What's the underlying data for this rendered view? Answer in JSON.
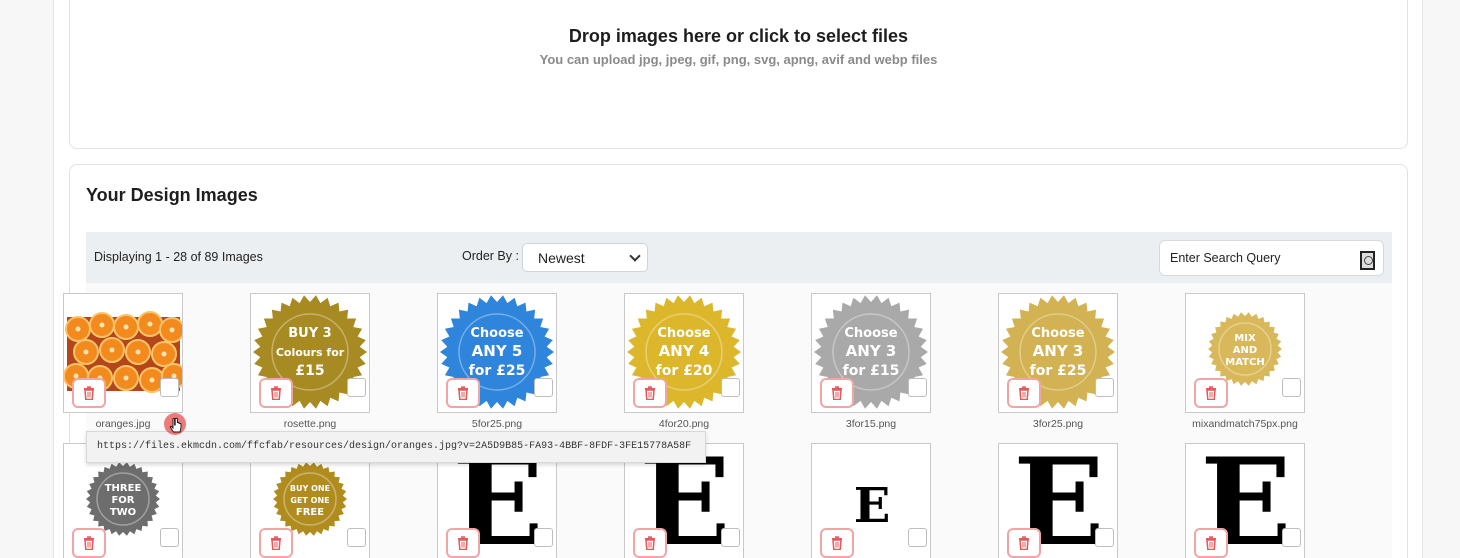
{
  "dropzone": {
    "title": "Drop images here or click to select files",
    "subtitle": "You can upload jpg, jpeg, gif, png, svg, apng, avif and webp files"
  },
  "design_images": {
    "title": "Your Design Images",
    "count_text": "Displaying 1 - 28 of 89 Images",
    "order_by_label": "Order By :",
    "order_by_value": "Newest",
    "search_placeholder": "Enter Search Query"
  },
  "images_row1": [
    {
      "filename": "oranges.jpg",
      "kind": "photo"
    },
    {
      "filename": "rosette.png",
      "kind": "rosette",
      "color": "#a88a23",
      "lines": [
        "BUY 3",
        "Colours for",
        "£15"
      ]
    },
    {
      "filename": "5for25.png",
      "kind": "rosette",
      "color": "#2f85dc",
      "lines": [
        "Choose",
        "ANY 5",
        "for £25"
      ]
    },
    {
      "filename": "4for20.png",
      "kind": "rosette",
      "color": "#dcb72c",
      "lines": [
        "Choose",
        "ANY 4",
        "for £20"
      ]
    },
    {
      "filename": "3for15.png",
      "kind": "rosette",
      "color": "#a9a9a9",
      "lines": [
        "Choose",
        "ANY 3",
        "for £15"
      ]
    },
    {
      "filename": "3for25.png",
      "kind": "rosette",
      "color": "#d2b252",
      "lines": [
        "Choose",
        "ANY 3",
        "for £25"
      ]
    },
    {
      "filename": "mixandmatch75px.png",
      "kind": "rosette-small",
      "color": "#d8b85a",
      "lines": [
        "MIX",
        "AND",
        "MATCH"
      ]
    }
  ],
  "images_row2": [
    {
      "kind": "rosette-small",
      "color": "#6d6d6d",
      "lines": [
        "THREE",
        "FOR",
        "TWO"
      ]
    },
    {
      "kind": "rosette-small",
      "color": "#b08c1f",
      "lines": [
        "BUY ONE",
        "GET ONE",
        "FREE"
      ]
    },
    {
      "kind": "letter-big",
      "letter": "E"
    },
    {
      "kind": "letter-big",
      "letter": "E"
    },
    {
      "kind": "letter-small",
      "letter": "E"
    },
    {
      "kind": "letter-big",
      "letter": "E"
    },
    {
      "kind": "letter-big",
      "letter": "E"
    }
  ],
  "tooltip": {
    "text": "https://files.ekmcdn.com/ffcfab/resources/design/oranges.jpg?v=2A5D9B85-FA93-4BBF-8FDF-3FE15778A58F"
  },
  "colors": {
    "delete_border": "#f1a6a6",
    "delete_icon": "#e05a5a",
    "toolbar_bg": "#eceff1"
  },
  "icons": {
    "delete": "trash-icon",
    "search": "search-icon",
    "dropdown": "chevron-down-icon"
  }
}
